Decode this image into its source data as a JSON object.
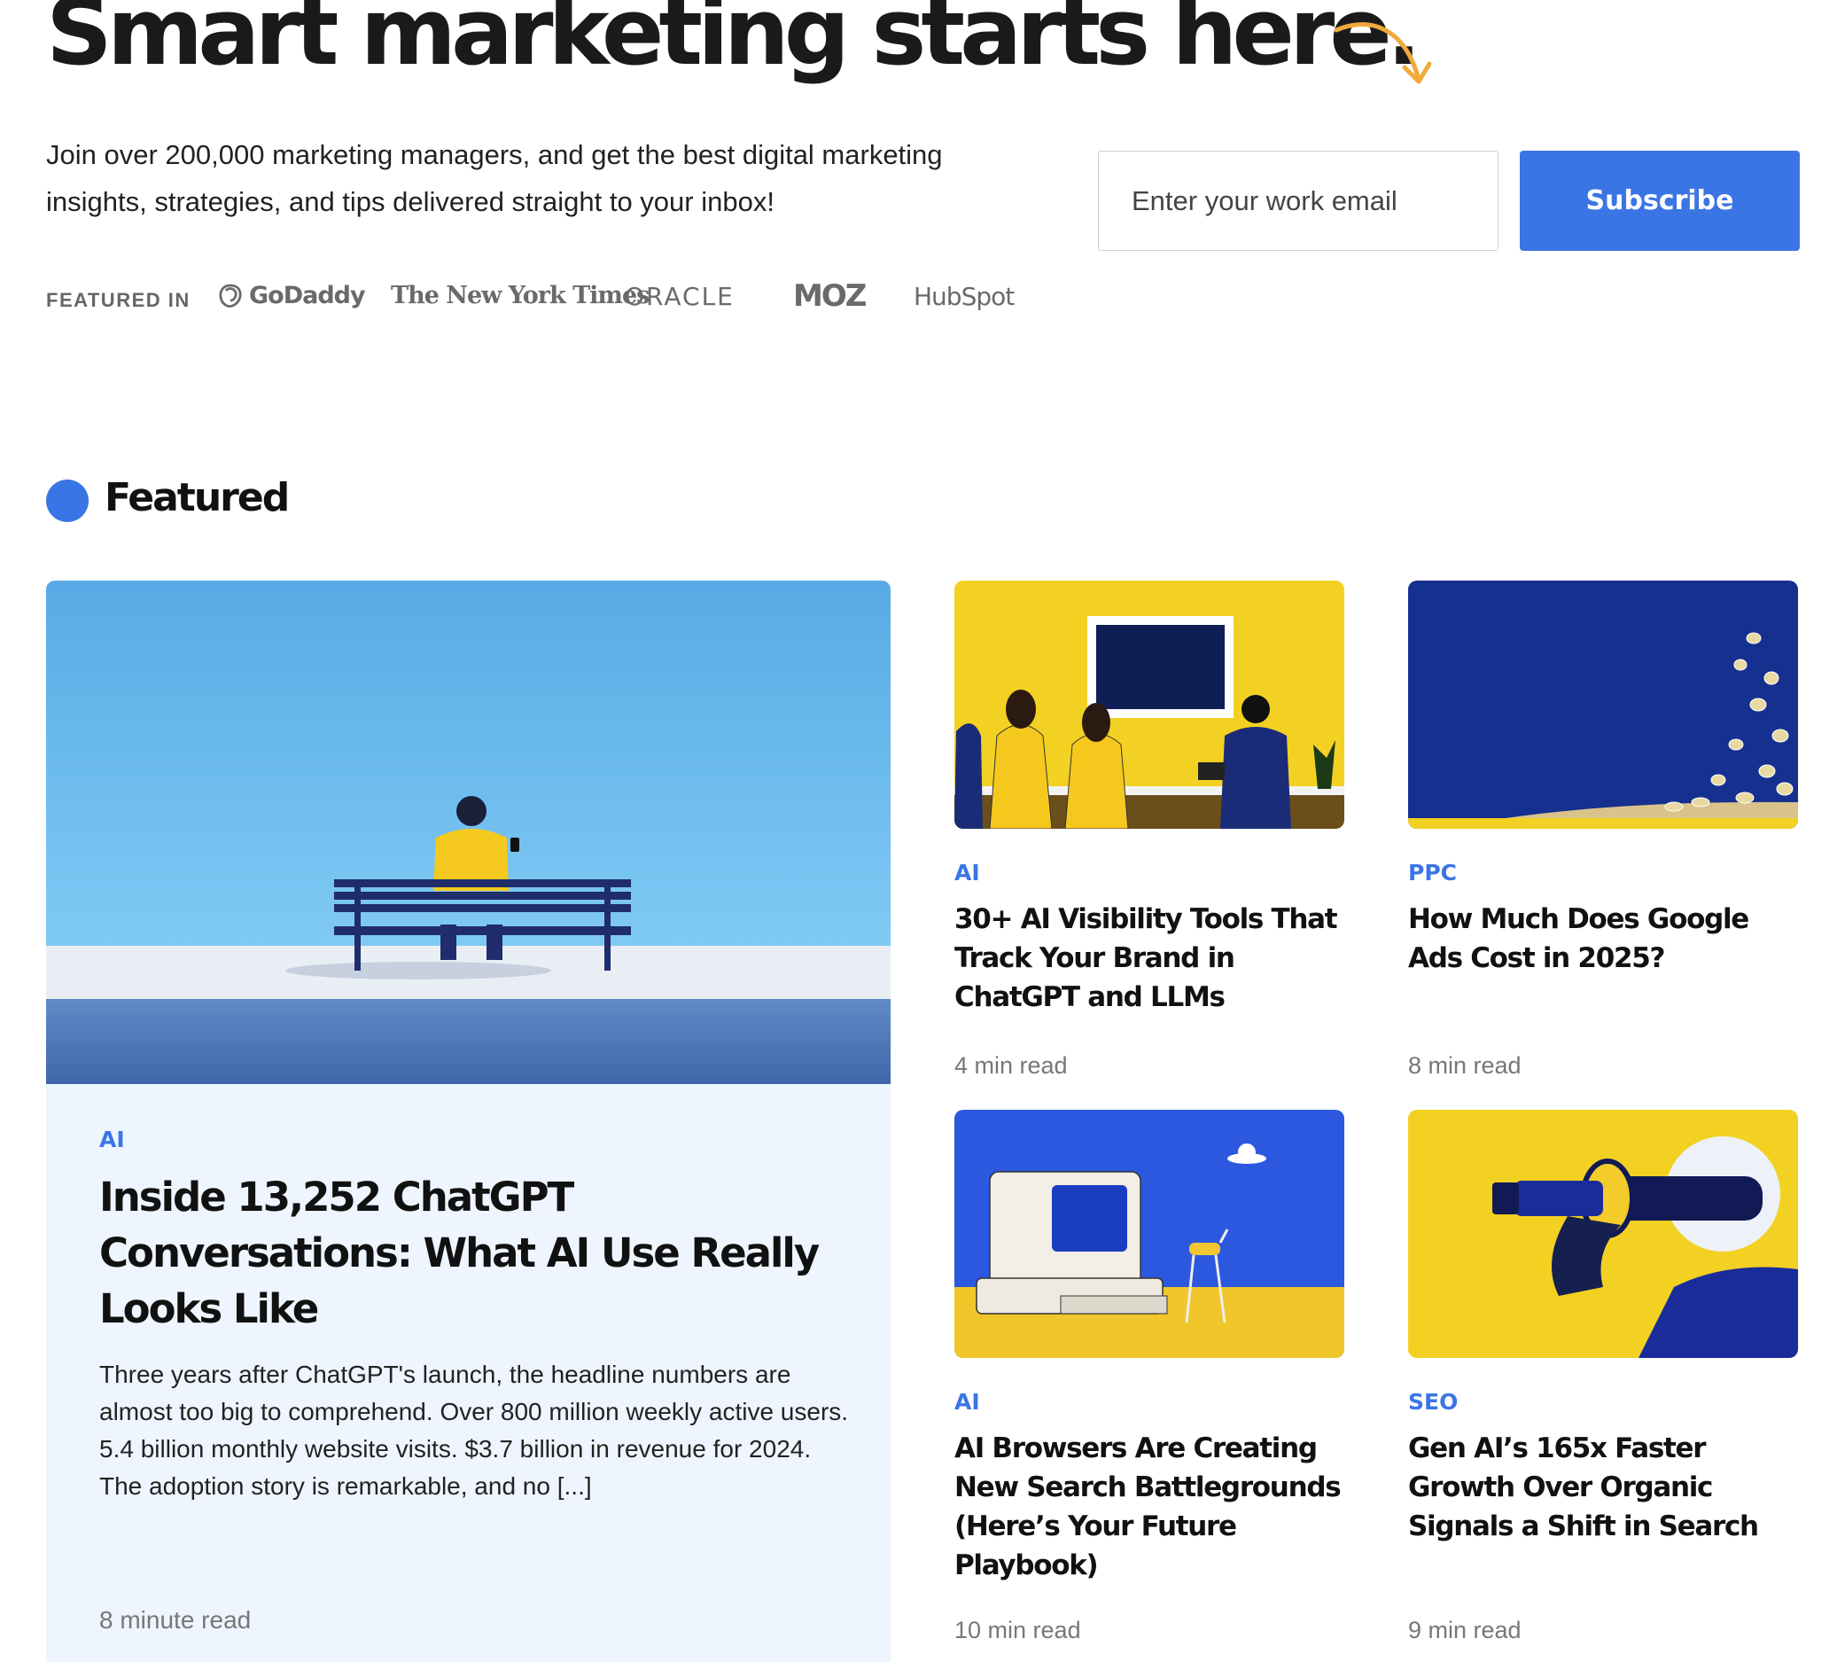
{
  "hero": {
    "title": "Smart marketing starts here.",
    "intro": "Join over 200,000 marketing managers, and get the best digital marketing insights, strategies, and tips delivered straight to your inbox!",
    "email_placeholder": "Enter your work email",
    "email_value": "",
    "subscribe_label": "Subscribe",
    "accent_color": "#3a75e5",
    "arrow_color": "#f0a93b"
  },
  "featured_in": {
    "label": "FEATURED IN",
    "logos": [
      "GoDaddy",
      "The New York Times",
      "ORACLE",
      "MOZ",
      "HubSpot"
    ]
  },
  "section": {
    "title": "Featured"
  },
  "main_article": {
    "category": "AI",
    "title": "Inside 13,252 ChatGPT Conversations: What AI Use Really Looks Like",
    "excerpt": "Three years after ChatGPT's launch, the headline numbers are almost too big to comprehend. Over 800 million weekly active users. 5.4 billion monthly website visits. $3.7 billion in revenue for 2024. The adoption story is remarkable, and no [...]",
    "read_time": "8 minute read"
  },
  "articles": [
    {
      "category": "AI",
      "title": "30+ AI Visibility Tools That Track Your Brand in ChatGPT and LLMs",
      "read_time": "4 min read"
    },
    {
      "category": "PPC",
      "title": "How Much Does Google Ads Cost in 2025?",
      "read_time": "8 min read"
    },
    {
      "category": "AI",
      "title": "AI Browsers Are Creating New Search Battlegrounds (Here’s Your Future Playbook)",
      "read_time": "10 min read"
    },
    {
      "category": "SEO",
      "title": "Gen AI’s 165x Faster Growth Over Organic Signals a Shift in Search",
      "read_time": "9 min read"
    }
  ]
}
